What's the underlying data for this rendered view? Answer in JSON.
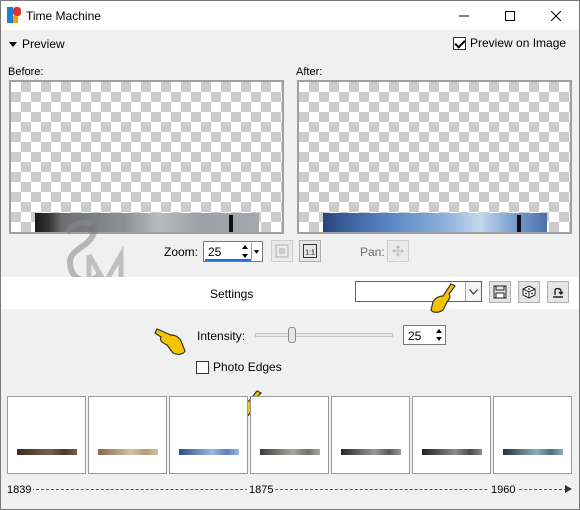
{
  "window": {
    "title": "Time Machine",
    "controls": [
      "minimize",
      "maximize",
      "close"
    ]
  },
  "preview": {
    "toggle_label": "Preview",
    "preview_on_image_label": "Preview on Image",
    "preview_on_image_checked": true,
    "before_label": "Before:",
    "after_label": "After:"
  },
  "zoom": {
    "label": "Zoom:",
    "value": "25",
    "zoom_fit_icon": "zoom-fit-icon",
    "actual_size_icon": "actual-size-icon",
    "actual_size_text": "1:1"
  },
  "pan": {
    "label": "Pan:",
    "icon": "move-icon"
  },
  "settings": {
    "label": "Settings",
    "selected": "",
    "save_icon": "save-icon",
    "randomize_icon": "dice-icon",
    "reset_icon": "reset-icon"
  },
  "intensity": {
    "label": "Intensity:",
    "value": "25",
    "slider_fraction": 0.25
  },
  "photo_edges": {
    "label": "Photo Edges",
    "checked": false
  },
  "presets": [
    {
      "name": "preset-1839",
      "colors": [
        "#3a2a1e",
        "#7a6048",
        "#4a3a2c"
      ]
    },
    {
      "name": "preset-2",
      "colors": [
        "#8a6a48",
        "#d6c0a0",
        "#b89878"
      ]
    },
    {
      "name": "preset-3",
      "colors": [
        "#2c4e8c",
        "#9ab8e0",
        "#5a80c0"
      ]
    },
    {
      "name": "preset-4",
      "colors": [
        "#3a3a3a",
        "#a8a8a0",
        "#707068"
      ]
    },
    {
      "name": "preset-5",
      "colors": [
        "#262626",
        "#9a9a9a",
        "#5a5a5a"
      ]
    },
    {
      "name": "preset-6",
      "colors": [
        "#202020",
        "#8c8c8c",
        "#4a4a4a"
      ]
    },
    {
      "name": "preset-7",
      "colors": [
        "#1e3438",
        "#8ab0b8",
        "#4a7078"
      ]
    }
  ],
  "timeline": {
    "labels": [
      "1839",
      "1875",
      "1960"
    ]
  },
  "pointer_color": "#f5c400"
}
